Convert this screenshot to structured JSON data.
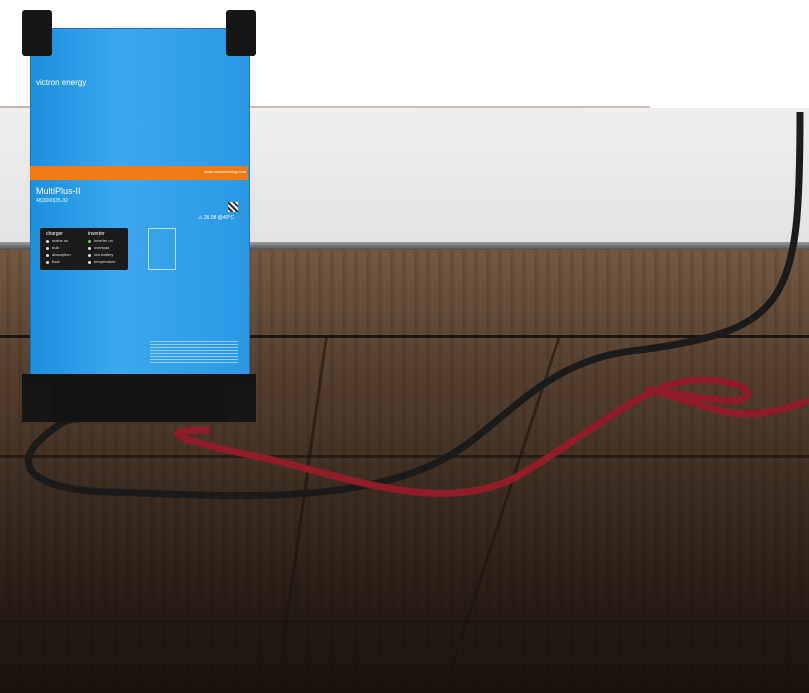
{
  "product": {
    "brand": "victron energy",
    "model": "MultiPlus-II",
    "spec": "48|3000|35-32",
    "orange_band_text": "www.victronenergy.com",
    "warning_text": "⚠ 26.08 @40°C"
  },
  "front_panel": {
    "charger_label": "charger",
    "inverter_label": "inverter",
    "charger_items": [
      "mains on",
      "bulk",
      "absorption",
      "float"
    ],
    "inverter_items": [
      "inverter on",
      "overload",
      "low battery",
      "temperature"
    ]
  }
}
